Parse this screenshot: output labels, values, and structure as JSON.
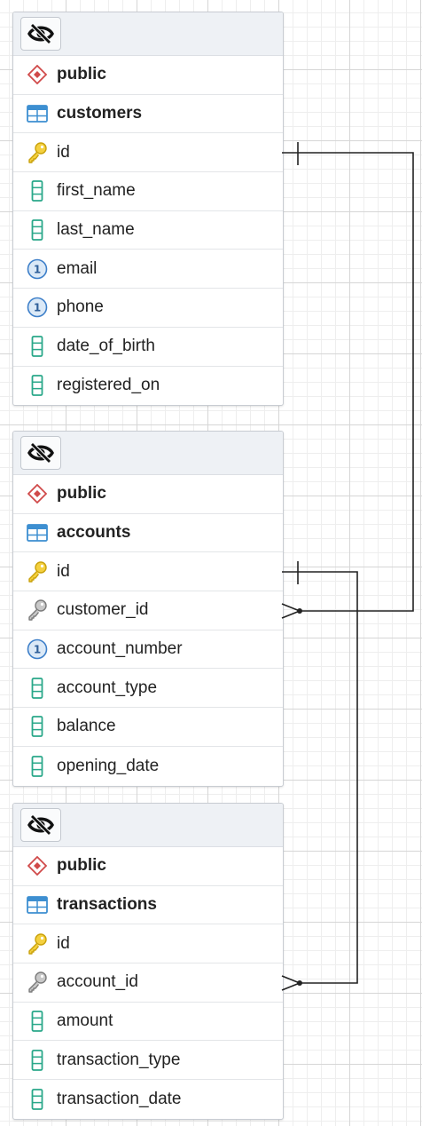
{
  "tables": [
    {
      "schema": "public",
      "name": "customers",
      "columns": [
        {
          "name": "id",
          "icon": "primary-key-icon"
        },
        {
          "name": "first_name",
          "icon": "column-icon"
        },
        {
          "name": "last_name",
          "icon": "column-icon"
        },
        {
          "name": "email",
          "icon": "unique-icon"
        },
        {
          "name": "phone",
          "icon": "unique-icon"
        },
        {
          "name": "date_of_birth",
          "icon": "column-icon"
        },
        {
          "name": "registered_on",
          "icon": "column-icon"
        }
      ]
    },
    {
      "schema": "public",
      "name": "accounts",
      "columns": [
        {
          "name": "id",
          "icon": "primary-key-icon"
        },
        {
          "name": "customer_id",
          "icon": "foreign-key-icon"
        },
        {
          "name": "account_number",
          "icon": "unique-icon"
        },
        {
          "name": "account_type",
          "icon": "column-icon"
        },
        {
          "name": "balance",
          "icon": "column-icon"
        },
        {
          "name": "opening_date",
          "icon": "column-icon"
        }
      ]
    },
    {
      "schema": "public",
      "name": "transactions",
      "columns": [
        {
          "name": "id",
          "icon": "primary-key-icon"
        },
        {
          "name": "account_id",
          "icon": "foreign-key-icon"
        },
        {
          "name": "amount",
          "icon": "column-icon"
        },
        {
          "name": "transaction_type",
          "icon": "column-icon"
        },
        {
          "name": "transaction_date",
          "icon": "column-icon"
        }
      ]
    }
  ],
  "relations": [
    {
      "from_table": "customers",
      "from_column": "id",
      "to_table": "accounts",
      "to_column": "customer_id",
      "cardinality": "one-to-many"
    },
    {
      "from_table": "accounts",
      "from_column": "id",
      "to_table": "transactions",
      "to_column": "account_id",
      "cardinality": "one-to-many"
    }
  ],
  "colors": {
    "schema_icon": "#d04a4a",
    "table_icon": "#3d8fd1",
    "primary_key": "#e6b820",
    "foreign_key": "#8a8a8a",
    "unique_icon": "#3d7fc9",
    "column_icon": "#2aa88a",
    "connector": "#222222"
  }
}
